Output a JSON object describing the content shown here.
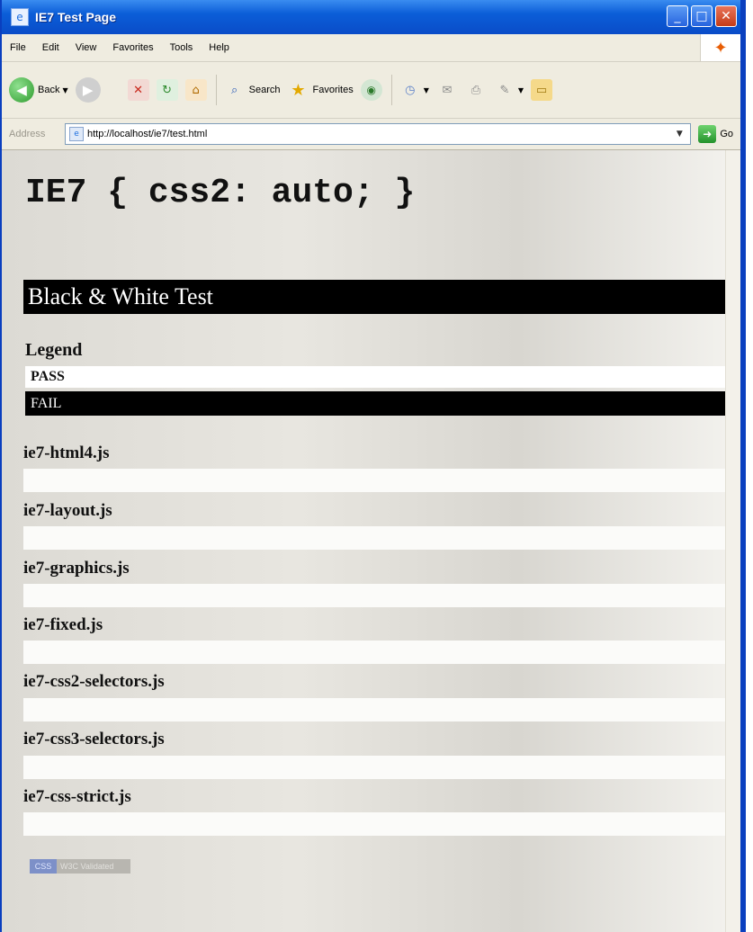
{
  "window": {
    "title": "IE7 Test Page",
    "minimize": "_",
    "maximize": "□",
    "close": "✕"
  },
  "menu": [
    "File",
    "Edit",
    "View",
    "Favorites",
    "Tools",
    "Help"
  ],
  "toolbar": {
    "back": "Back",
    "search": "Search",
    "favorites": "Favorites"
  },
  "address": {
    "label": "Address",
    "url": "http://localhost/ie7/test.html",
    "go": "Go"
  },
  "page": {
    "heading": "IE7 { css2: auto; }",
    "section_title": "Black & White Test",
    "legend_label": "Legend",
    "pass_label": "PASS",
    "fail_label": "FAIL",
    "tests": [
      "ie7-html4.js",
      "ie7-layout.js",
      "ie7-graphics.js",
      "ie7-fixed.js",
      "ie7-css2-selectors.js",
      "ie7-css3-selectors.js",
      "ie7-css-strict.js"
    ],
    "badge": [
      "CSS",
      "W3C Validated"
    ]
  },
  "colors": {
    "titlebar": "#0a4cc8",
    "pass_bg": "#ffffff",
    "fail_bg": "#000000"
  }
}
